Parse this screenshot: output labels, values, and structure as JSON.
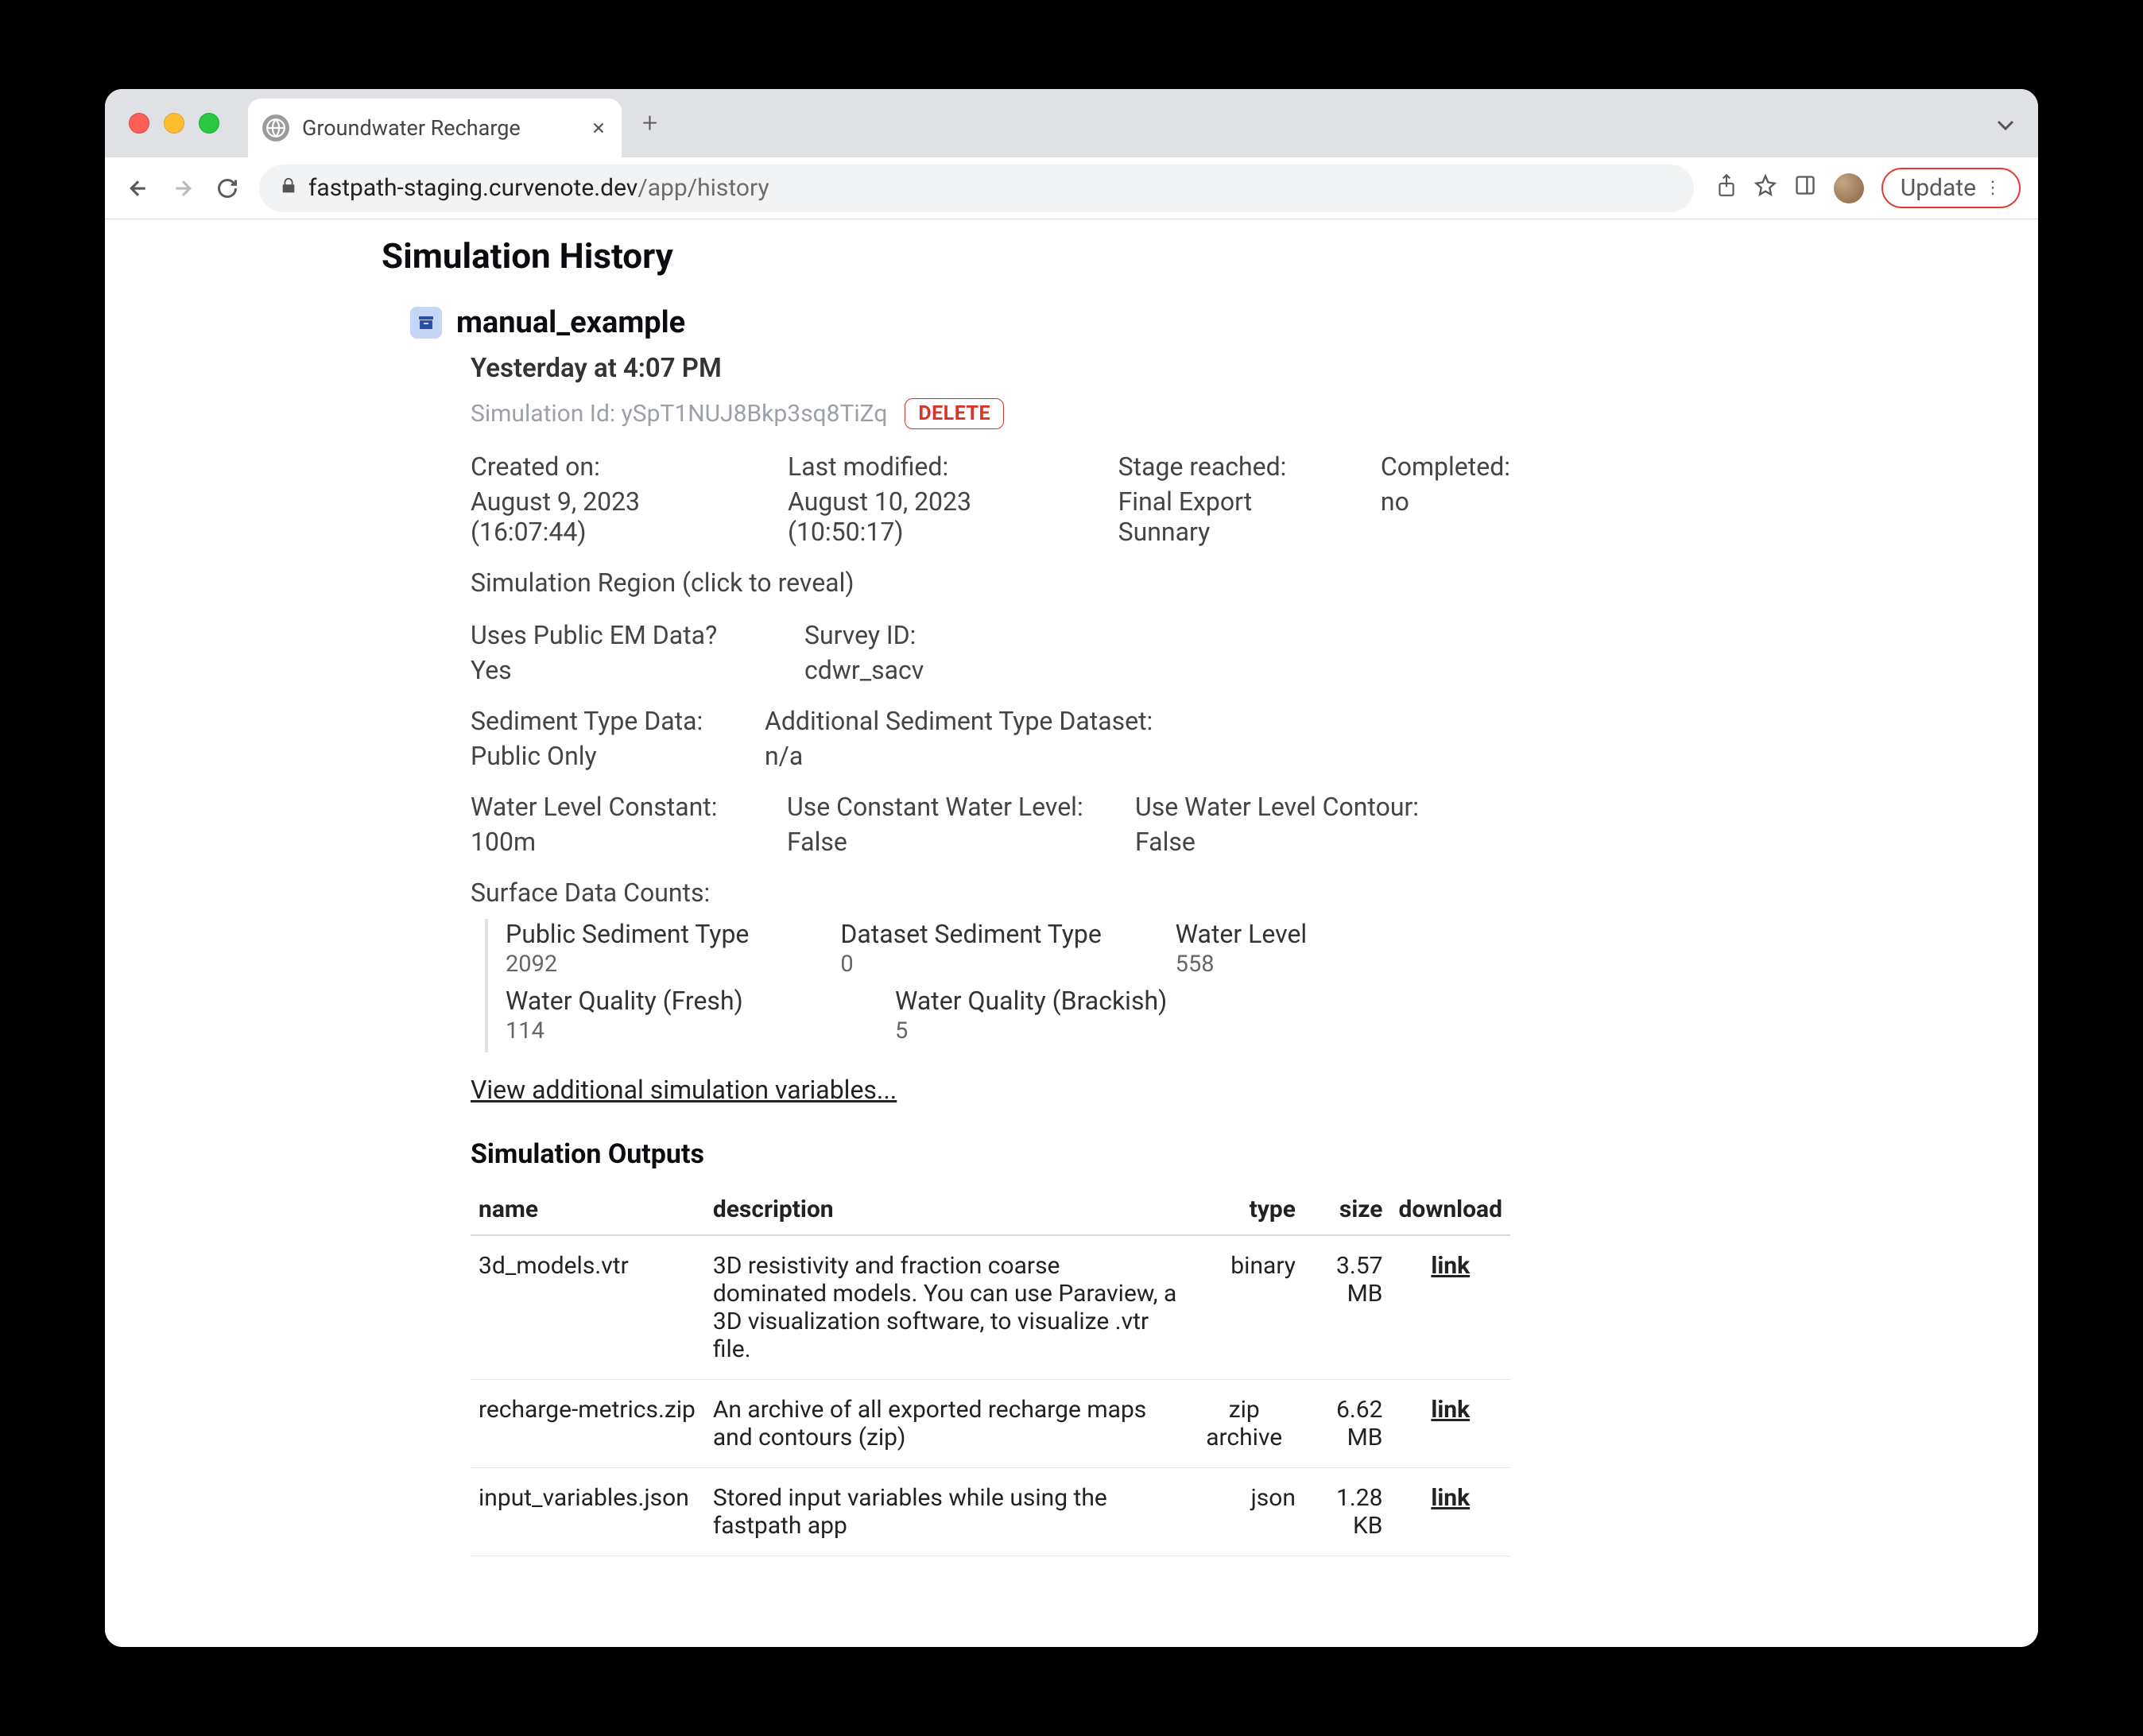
{
  "browser": {
    "tab_title": "Groundwater Recharge",
    "url_host": "fastpath-staging.curvenote.dev",
    "url_path": "/app/history",
    "update_button": "Update"
  },
  "page": {
    "title": "Simulation History",
    "sim_name": "manual_example",
    "sim_time": "Yesterday at 4:07 PM",
    "sim_id_label": "Simulation Id: ySpT1NUJ8Bkp3sq8TiZq",
    "delete_label": "DELETE",
    "meta": {
      "created_label": "Created on:",
      "created_value": "August 9, 2023 (16:07:44)",
      "modified_label": "Last modified:",
      "modified_value": "August 10, 2023 (10:50:17)",
      "stage_label": "Stage reached:",
      "stage_value": "Final Export Sunnary",
      "completed_label": "Completed:",
      "completed_value": "no"
    },
    "reveal_label": "Simulation Region (click to reveal)",
    "em": {
      "uses_label": "Uses Public EM Data?",
      "uses_value": "Yes",
      "survey_label": "Survey ID:",
      "survey_value": "cdwr_sacv"
    },
    "sed": {
      "data_label": "Sediment Type Data:",
      "data_value": "Public Only",
      "add_label": "Additional Sediment Type Dataset:",
      "add_value": "n/a"
    },
    "water": {
      "wlc_label": "Water Level Constant:",
      "wlc_value": "100m",
      "ucwl_label": "Use Constant Water Level:",
      "ucwl_value": "False",
      "uwlc_label": "Use Water Level Contour:",
      "uwlc_value": "False"
    },
    "surface_counts_title": "Surface Data Counts:",
    "surface_counts": {
      "public_sed_label": "Public Sediment Type",
      "public_sed_value": "2092",
      "dataset_sed_label": "Dataset Sediment Type",
      "dataset_sed_value": "0",
      "water_level_label": "Water Level",
      "water_level_value": "558",
      "wq_fresh_label": "Water Quality (Fresh)",
      "wq_fresh_value": "114",
      "wq_brack_label": "Water Quality (Brackish)",
      "wq_brack_value": "5"
    },
    "view_more": "View additional simulation variables...",
    "outputs_title": "Simulation Outputs",
    "output_cols": {
      "name": "name",
      "description": "description",
      "type": "type",
      "size": "size",
      "download": "download"
    },
    "outputs": [
      {
        "name": "3d_models.vtr",
        "desc": "3D resistivity and fraction coarse dominated models. You can use Paraview, a 3D visualization software, to visualize .vtr file.",
        "type": "binary",
        "size": "3.57 MB",
        "dl": "link"
      },
      {
        "name": "recharge-metrics.zip",
        "desc": "An archive of all exported recharge maps and contours (zip)",
        "type": "zip archive",
        "size": "6.62 MB",
        "dl": "link"
      },
      {
        "name": "input_variables.json",
        "desc": "Stored input variables while using the fastpath app",
        "type": "json",
        "size": "1.28 KB",
        "dl": "link"
      }
    ]
  }
}
